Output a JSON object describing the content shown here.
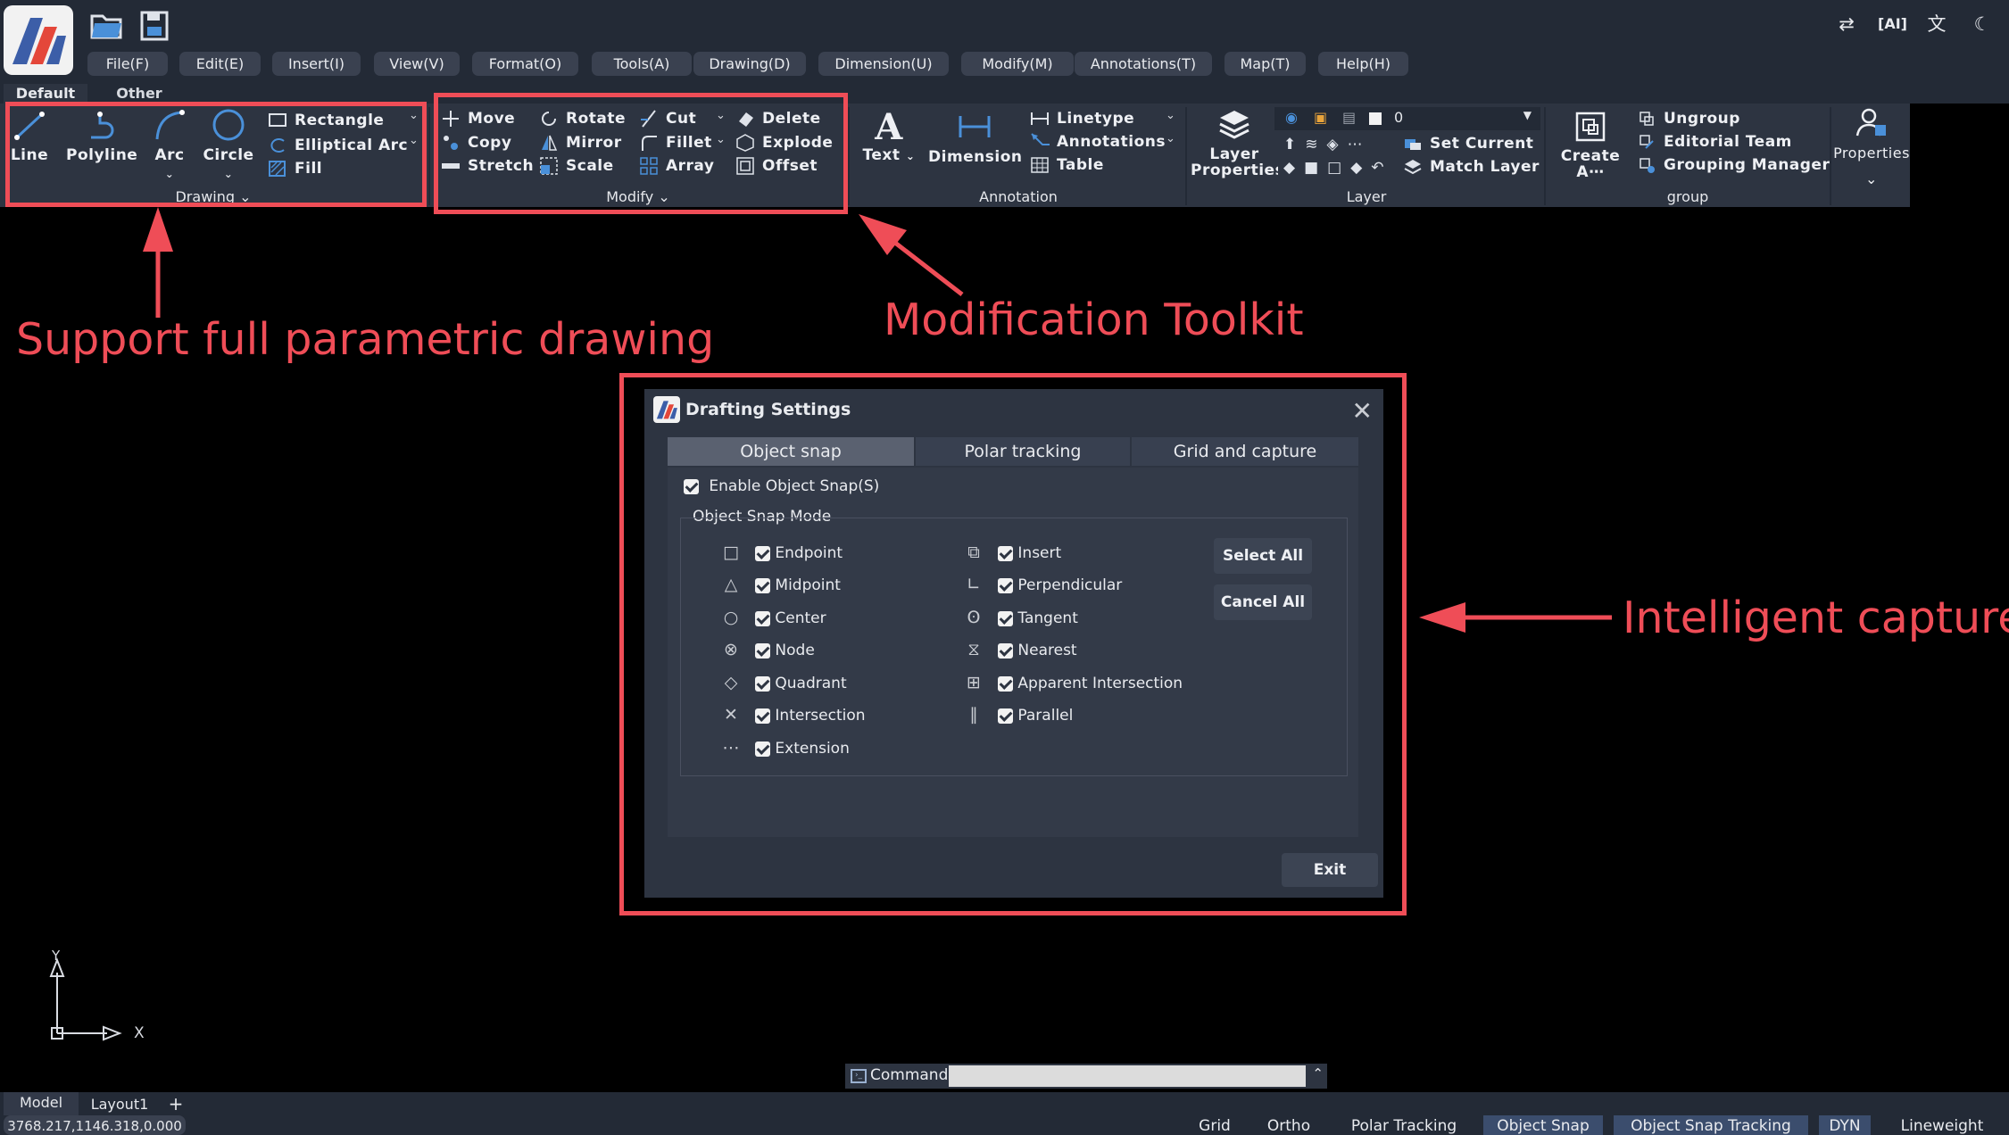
{
  "menu": [
    "File(F)",
    "Edit(E)",
    "Insert(I)",
    "View(V)",
    "Format(O)",
    "Tools(A)",
    "Drawing(D)",
    "Dimension(U)",
    "Modify(M)",
    "Annotations(T)",
    "Map(T)",
    "Help(H)"
  ],
  "ribbon_tabs": [
    "Default",
    "Other"
  ],
  "drawing": {
    "title": "Drawing",
    "big": [
      "Line",
      "Polyline",
      "Arc",
      "Circle"
    ],
    "small": [
      "Rectangle",
      "Elliptical Arc",
      "Fill"
    ]
  },
  "modify": {
    "title": "Modify",
    "col1": [
      "Move",
      "Copy",
      "Stretch"
    ],
    "col2": [
      "Rotate",
      "Mirror",
      "Scale"
    ],
    "col3": [
      "Cut",
      "Fillet",
      "Array"
    ],
    "col4": [
      "Delete",
      "Explode",
      "Offset"
    ]
  },
  "annotation": {
    "title": "Annotation",
    "text": "Text",
    "dimension": "Dimension",
    "small": [
      "Linetype",
      "Annotations",
      "Table"
    ]
  },
  "layer": {
    "title": "Layer",
    "properties": "Layer Properties",
    "current_layer": "0",
    "set_current": "Set Current",
    "match_layer": "Match Layer"
  },
  "group": {
    "title": "group",
    "create": "Create A⋯",
    "small": [
      "Ungroup",
      "Editorial Team",
      "Grouping Manager"
    ]
  },
  "properties": {
    "label": "Properties"
  },
  "callouts": {
    "drawing": "Support full parametric drawing",
    "modify": "Modification Toolkit",
    "snap": "Intelligent capture"
  },
  "dialog": {
    "title": "Drafting Settings",
    "tabs": [
      "Object snap",
      "Polar tracking",
      "Grid and capture"
    ],
    "enable": "Enable Object Snap(S)",
    "mode_label": "Object Snap Mode",
    "left_modes": [
      "Endpoint",
      "Midpoint",
      "Center",
      "Node",
      "Quadrant",
      "Intersection",
      "Extension"
    ],
    "right_modes": [
      "Insert",
      "Perpendicular",
      "Tangent",
      "Nearest",
      "Apparent Intersection",
      "Parallel"
    ],
    "select_all": "Select All",
    "cancel_all": "Cancel All",
    "exit": "Exit"
  },
  "axis": {
    "x": "X",
    "y": "Y"
  },
  "command": {
    "label": "Command:",
    "value": ""
  },
  "layouts": [
    "Model",
    "Layout1",
    "+"
  ],
  "status": {
    "coords": "3768.217,1146.318,0.000",
    "buttons": [
      {
        "label": "Grid",
        "on": false
      },
      {
        "label": "Ortho",
        "on": false
      },
      {
        "label": "Polar Tracking",
        "on": false
      },
      {
        "label": "Object Snap",
        "on": true
      },
      {
        "label": "Object Snap Tracking",
        "on": true
      },
      {
        "label": "DYN",
        "on": true
      },
      {
        "label": "Lineweight",
        "on": false
      }
    ]
  },
  "colors": {
    "annotation_red": "#ef4d57",
    "panel_bg": "#2d3441",
    "topbar_bg": "#232a36",
    "status_on": "#3b4d6d"
  }
}
